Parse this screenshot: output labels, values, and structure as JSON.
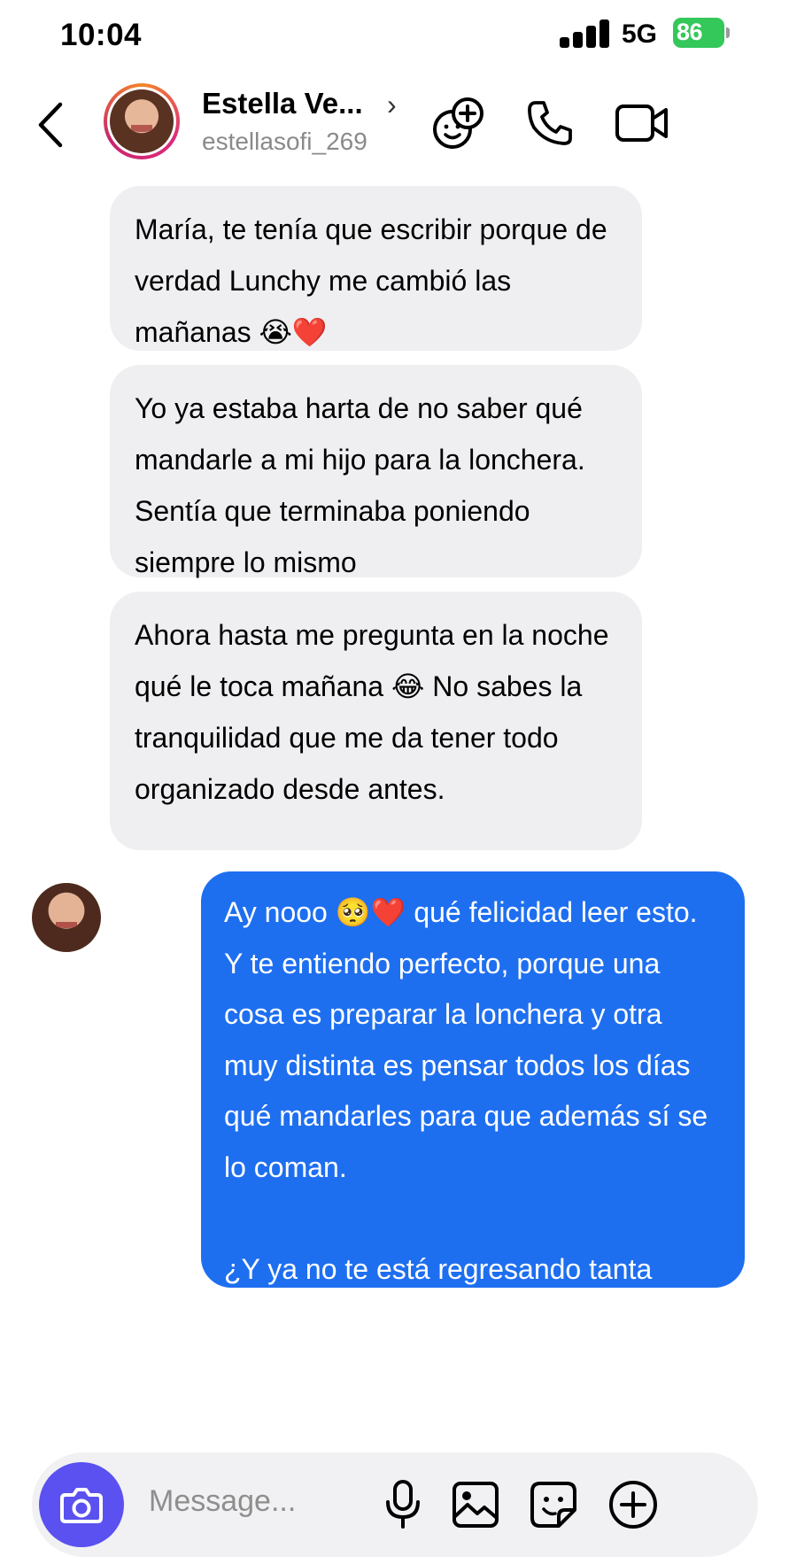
{
  "status_bar": {
    "time": "10:04",
    "network": "5G",
    "battery": "86"
  },
  "header": {
    "contact_name": "Estella Ve...",
    "contact_handle": "estellasofi_269",
    "chevron": "›",
    "icons": [
      "back-chevron-icon",
      "effects-icon",
      "phone-icon",
      "video-camera-icon"
    ]
  },
  "messages": [
    {
      "sender": "contact",
      "text": "María, te tenía que escribir porque de verdad Lunchy me cambió las mañanas 😭❤️"
    },
    {
      "sender": "contact",
      "text": "Yo ya estaba harta de no saber qué mandarle a mi hijo para la lonchera. Sentía que terminaba poniendo siempre lo mismo"
    },
    {
      "sender": "contact",
      "text": "Ahora hasta me pregunta en la noche qué le toca mañana 😂 No sabes la tranquilidad que me da tener todo organizado desde antes."
    },
    {
      "sender": "me",
      "text": "Ay nooo 🥺❤️ qué felicidad leer esto. Y te entiendo perfecto, porque una cosa es preparar la lonchera y otra muy distinta es pensar todos los días qué mandarles para que además sí se lo coman.\n\n¿Y ya no te está regresando tanta comida?"
    }
  ],
  "composer": {
    "placeholder": "Message...",
    "icons": [
      "camera-icon",
      "microphone-icon",
      "gallery-icon",
      "sticker-icon",
      "plus-icon"
    ]
  },
  "colors": {
    "outgoing_bubble": "#1e6ff0",
    "incoming_bubble": "#efeff1",
    "camera_button": "#5b51f0",
    "battery": "#34c759"
  }
}
